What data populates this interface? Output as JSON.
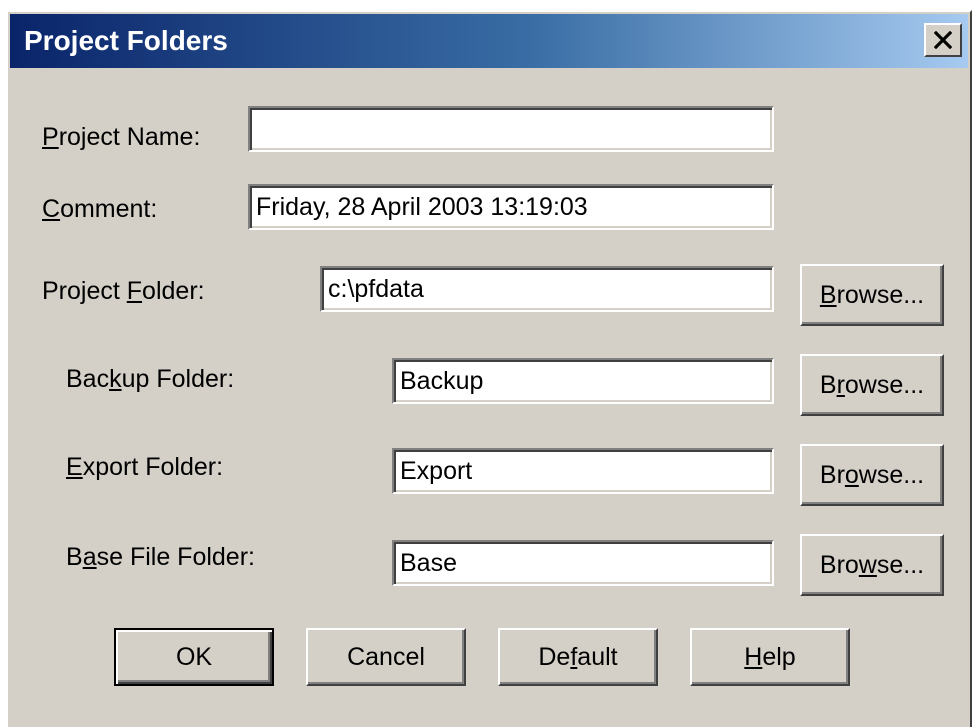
{
  "window": {
    "title": "Project Folders",
    "close_icon": "close-icon"
  },
  "form": {
    "project_name": {
      "label_pre": "",
      "label_key": "P",
      "label_post": "roject Name:",
      "value": ""
    },
    "comment": {
      "label_pre": "",
      "label_key": "C",
      "label_post": "omment:",
      "value": "Friday, 28 April 2003 13:19:03"
    },
    "project_folder": {
      "label_pre": "Project ",
      "label_key": "F",
      "label_post": "older:",
      "value": "c:\\pfdata"
    },
    "backup_folder": {
      "label_pre": "Bac",
      "label_key": "k",
      "label_post": "up Folder:",
      "value": "Backup"
    },
    "export_folder": {
      "label_pre": "",
      "label_key": "E",
      "label_post": "xport Folder:",
      "value": "Export"
    },
    "base_folder": {
      "label_pre": "B",
      "label_key": "a",
      "label_post": "se File Folder:",
      "value": "Base"
    }
  },
  "browse_buttons": [
    {
      "pre": "",
      "key": "B",
      "post": "rowse..."
    },
    {
      "pre": "B",
      "key": "r",
      "post": "owse..."
    },
    {
      "pre": "Br",
      "key": "o",
      "post": "wse..."
    },
    {
      "pre": "Bro",
      "key": "w",
      "post": "se..."
    }
  ],
  "actions": {
    "ok": {
      "pre": "OK",
      "key": "",
      "post": ""
    },
    "cancel": {
      "pre": "Cancel",
      "key": "",
      "post": ""
    },
    "default": {
      "pre": "De",
      "key": "f",
      "post": "ault"
    },
    "help": {
      "pre": "",
      "key": "H",
      "post": "elp"
    }
  },
  "colors": {
    "dialog_bg": "#d4d0c8",
    "title_gradient_start": "#0a246a",
    "title_gradient_end": "#a6caf0",
    "title_text": "#ffffff"
  }
}
